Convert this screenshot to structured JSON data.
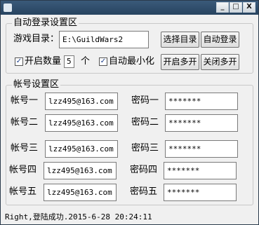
{
  "window": {
    "controls": {
      "minimize": "_",
      "maximize": "□",
      "close": "X"
    }
  },
  "auto_login": {
    "title": "自动登录设置区",
    "game_dir_label": "游戏目录：",
    "game_dir_value": "E:\\GuildWars2",
    "select_dir_button": "选择目录",
    "auto_login_button": "自动登录",
    "multi_count_label": "开启数量",
    "multi_count_checked": true,
    "multi_count_value": "5",
    "multi_count_unit": "个",
    "auto_minimize_label": "自动最小化",
    "auto_minimize_checked": true,
    "open_multi_button": "开启多开",
    "close_multi_button": "关闭多开"
  },
  "accounts": {
    "title": "帐号设置区",
    "rows": [
      {
        "account_label": "帐号一",
        "account_value": "lzz495@163.com",
        "password_label": "密码一",
        "password_value": "*******"
      },
      {
        "account_label": "帐号二",
        "account_value": "lzz495@163.com",
        "password_label": "密码二",
        "password_value": "*******"
      },
      {
        "account_label": "帐号三",
        "account_value": "lzz495@163.com",
        "password_label": "密码三",
        "password_value": "*******"
      },
      {
        "account_label": "帐号四",
        "account_value": "lzz495@163.com",
        "password_label": "密码四",
        "password_value": "*******"
      },
      {
        "account_label": "帐号五",
        "account_value": "lzz495@163.com",
        "password_label": "密码五",
        "password_value": "*******"
      }
    ]
  },
  "status": {
    "text": "Right,登陆成功.2015-6-28 20:24:11"
  }
}
